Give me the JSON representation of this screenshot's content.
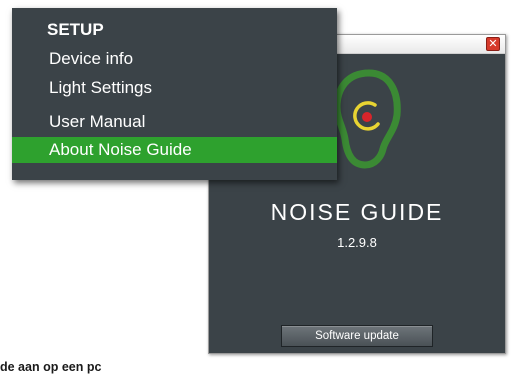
{
  "setup_menu": {
    "title": "SETUP",
    "items": [
      {
        "label": "Device info"
      },
      {
        "label": "Light Settings"
      },
      {
        "label": "User Manual"
      },
      {
        "label": "About Noise Guide",
        "selected": true
      }
    ]
  },
  "about_window": {
    "close_icon": "close-icon",
    "logo_icon": "ear-icon",
    "app_name": "NOISE GUIDE",
    "version": "1.2.9.8",
    "update_button_label": "Software update"
  },
  "caption": "de aan op een pc",
  "colors": {
    "panel_bg": "#3b4348",
    "selected_bg": "#2ea12e",
    "logo_green": "#3b8a34",
    "logo_yellow": "#e8d432",
    "logo_red": "#d8252b"
  }
}
